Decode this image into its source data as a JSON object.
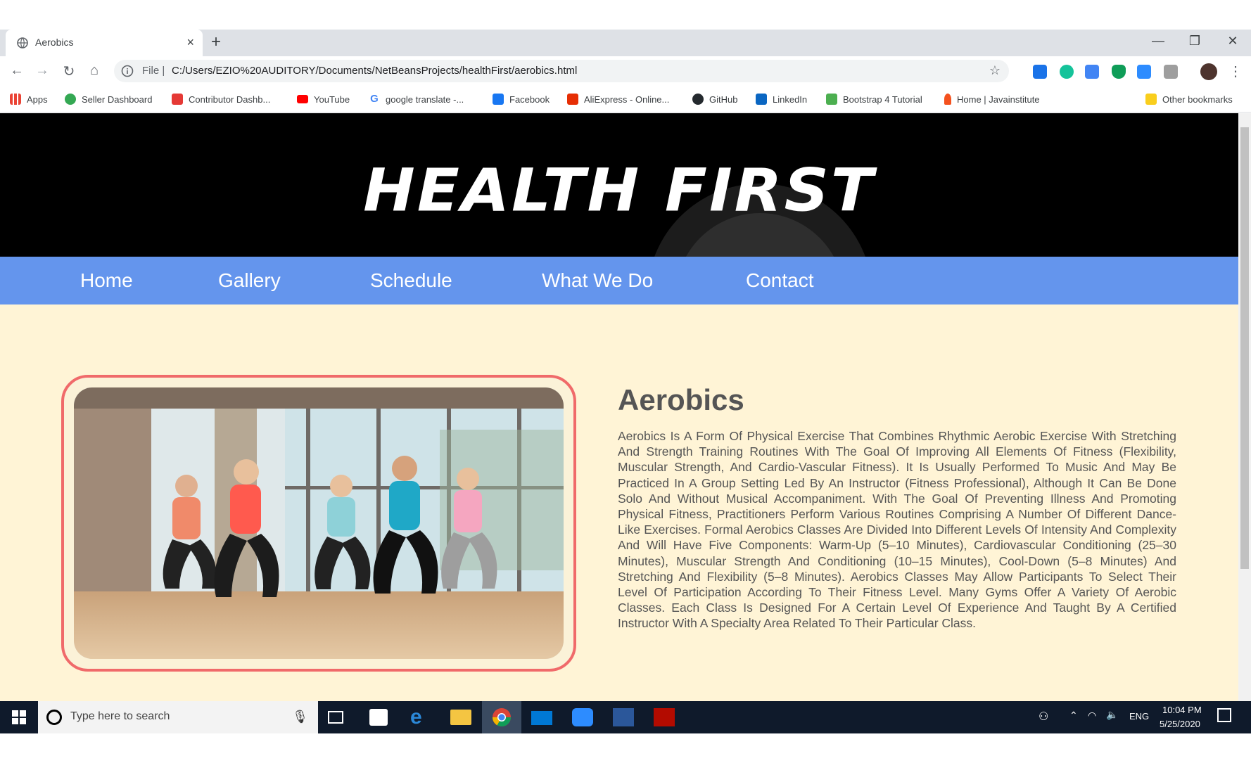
{
  "browser": {
    "tab_title": "Aerobics",
    "tab_close": "×",
    "new_tab": "+",
    "window_controls": {
      "minimize": "—",
      "restore": "❐",
      "close": "✕"
    },
    "nav": {
      "back": "←",
      "forward": "→",
      "reload": "↻",
      "home": "⌂"
    },
    "address": {
      "scheme": "File",
      "separator": "|",
      "url": "C:/Users/EZIO%20AUDITORY/Documents/NetBeansProjects/healthFirst/aerobics.html"
    },
    "star": "☆",
    "bookmarks": [
      {
        "label": "Apps",
        "icon": "apps-grid-icon",
        "color": "#ea4335"
      },
      {
        "label": "Seller Dashboard",
        "icon": "seller-icon",
        "color": "#34a853"
      },
      {
        "label": "Contributor Dashb...",
        "icon": "contributor-icon",
        "color": "#e53935"
      },
      {
        "label": "YouTube",
        "icon": "youtube-icon",
        "color": "#ff0000"
      },
      {
        "label": "google translate -...",
        "icon": "google-icon",
        "color": "#4285f4"
      },
      {
        "label": "Facebook",
        "icon": "facebook-icon",
        "color": "#1877f2"
      },
      {
        "label": "AliExpress - Online...",
        "icon": "aliexpress-icon",
        "color": "#e62e04"
      },
      {
        "label": "GitHub",
        "icon": "github-icon",
        "color": "#24292e"
      },
      {
        "label": "LinkedIn",
        "icon": "linkedin-icon",
        "color": "#0a66c2"
      },
      {
        "label": "Bootstrap 4 Tutorial",
        "icon": "w3schools-icon",
        "color": "#4caf50"
      },
      {
        "label": "Home | Javainstitute",
        "icon": "java-icon",
        "color": "#f4511e"
      }
    ],
    "other_bookmarks": "Other bookmarks"
  },
  "site": {
    "logo_text": "HEALTH FIRST",
    "nav": [
      "Home",
      "Gallery",
      "Schedule",
      "What We Do",
      "Contact"
    ],
    "colors": {
      "nav": "#6495ed",
      "background": "#fff4d6",
      "frame": "#f06a6a",
      "text": "#555555"
    },
    "article": {
      "title": "Aerobics",
      "body": "Aerobics Is A Form Of Physical Exercise That Combines Rhythmic Aerobic Exercise With Stretching And Strength Training Routines With The Goal Of Improving All Elements Of Fitness (Flexibility, Muscular Strength, And Cardio-Vascular Fitness). It Is Usually Performed To Music And May Be Practiced In A Group Setting Led By An Instructor (Fitness Professional), Although It Can Be Done Solo And Without Musical Accompaniment. With The Goal Of Preventing Illness And Promoting Physical Fitness, Practitioners Perform Various Routines Comprising A Number Of Different Dance-Like Exercises. Formal Aerobics Classes Are Divided Into Different Levels Of Intensity And Complexity And Will Have Five Components: Warm-Up (5–10 Minutes), Cardiovascular Conditioning (25–30 Minutes), Muscular Strength And Conditioning (10–15 Minutes), Cool-Down (5–8 Minutes) And Stretching And Flexibility (5–8 Minutes). Aerobics Classes May Allow Participants To Select Their Level Of Participation According To Their Fitness Level. Many Gyms Offer A Variety Of Aerobic Classes. Each Class Is Designed For A Certain Level Of Experience And Taught By A Certified Instructor With A Specialty Area Related To Their Particular Class."
    }
  },
  "taskbar": {
    "search_placeholder": "Type here to search",
    "language": "ENG",
    "time": "10:04 PM",
    "date": "5/25/2020"
  }
}
